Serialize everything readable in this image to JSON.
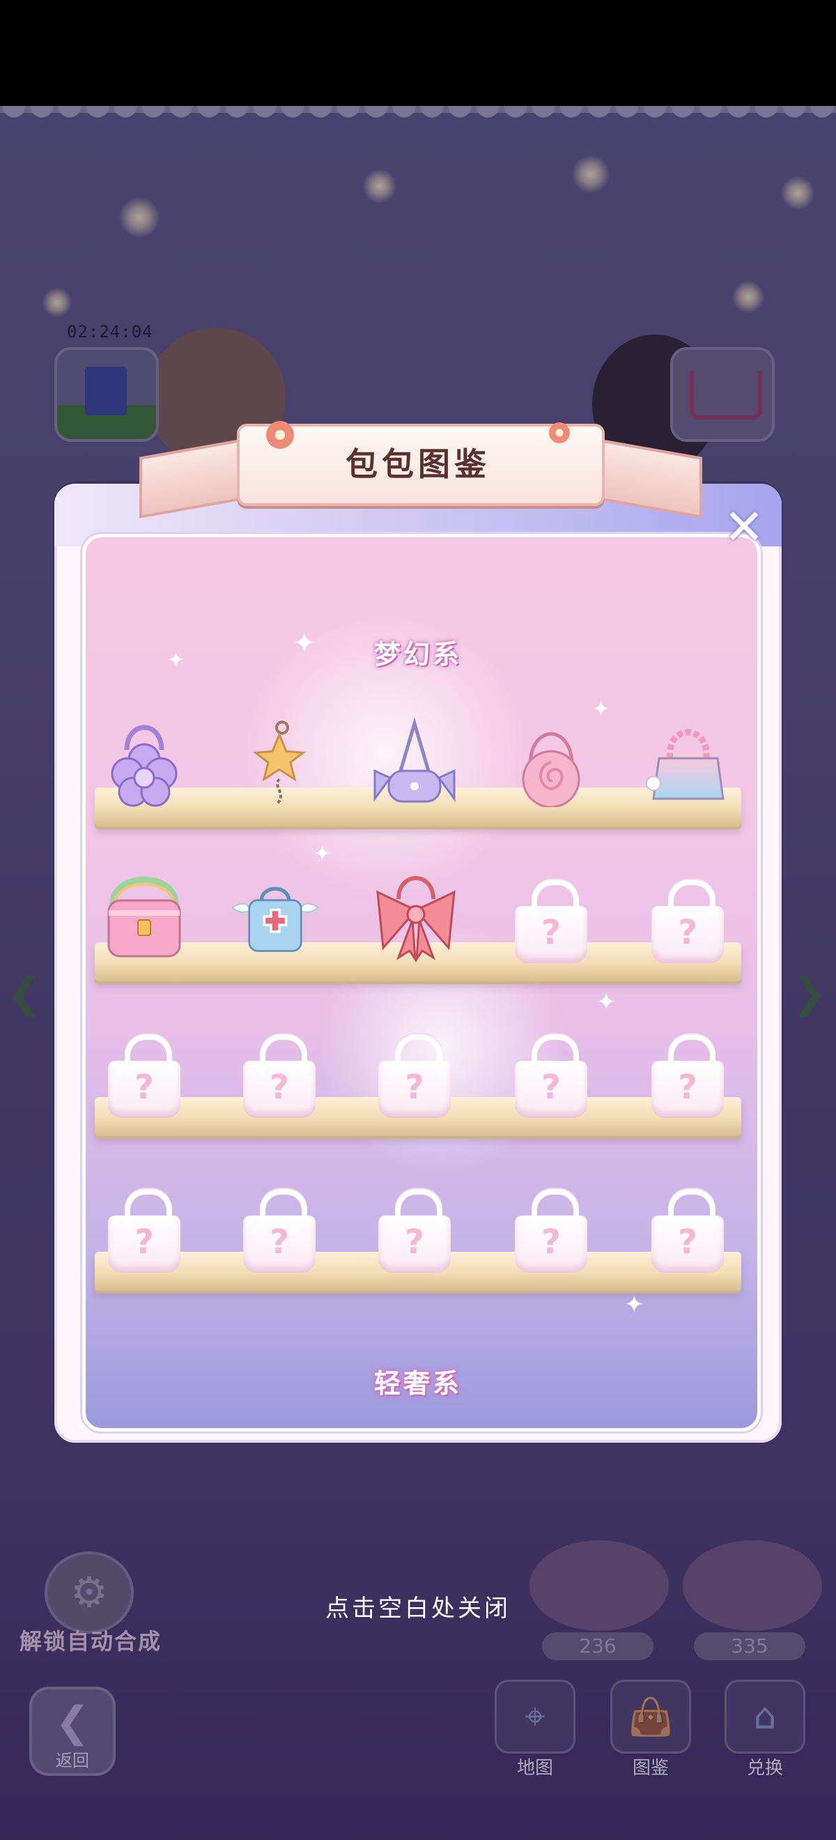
{
  "game": {
    "timer": "02:24:04",
    "hint": "点击空白处关闭",
    "auto_merge_label": "解锁自动合成",
    "back_label": "返回",
    "counts": {
      "left": "236",
      "right": "335"
    },
    "nav": [
      {
        "label": "地图",
        "icon": "map-icon"
      },
      {
        "label": "图鉴",
        "icon": "handbag-icon"
      },
      {
        "label": "兑换",
        "icon": "shop-icon"
      }
    ]
  },
  "modal": {
    "title": "包包图鉴",
    "category_top": "梦幻系",
    "category_bottom": "轻奢系",
    "locked_symbol": "?",
    "close_glyph": "✕",
    "shelves": [
      {
        "items": [
          "purple-flower-bag",
          "star-charm",
          "candy-bag",
          "pink-rose-bag",
          "gradient-pearl-bag"
        ]
      },
      {
        "items": [
          "pink-satchel-bag",
          "angel-wing-nurse-bag",
          "red-bow-bag",
          "locked",
          "locked"
        ]
      },
      {
        "items": [
          "locked",
          "locked",
          "locked",
          "locked",
          "locked"
        ]
      },
      {
        "items": [
          "locked",
          "locked",
          "locked",
          "locked",
          "locked"
        ]
      }
    ],
    "colors": {
      "panel_pink": "#f6c8e2",
      "panel_violet": "#9d98dd",
      "shelf_wood": "#f2dcb5",
      "category_glow": "#d16fbf"
    }
  }
}
